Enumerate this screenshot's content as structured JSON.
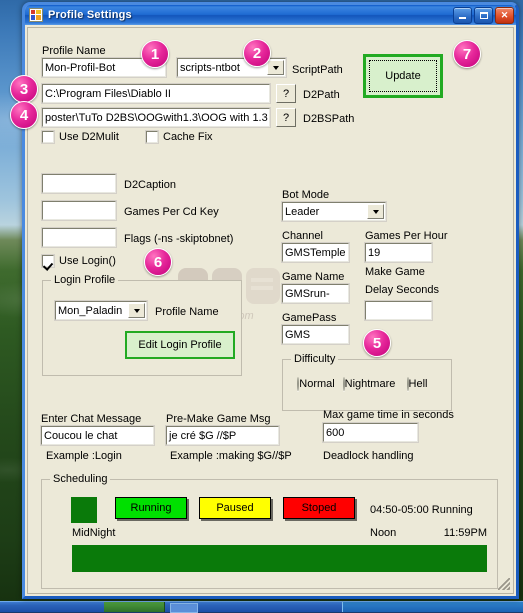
{
  "window": {
    "title": "Profile Settings",
    "icon": "profile-settings-icon",
    "buttons": {
      "minimize": "minimize",
      "maximize": "maximize",
      "close": "close"
    }
  },
  "profile": {
    "name_label": "Profile Name",
    "name_value": "Mon-Profil-Bot",
    "script_value": "scripts-ntbot",
    "script_label": "ScriptPath",
    "d2path_value": "C:\\Program Files\\Diablo II",
    "d2path_label": "D2Path",
    "d2path_browse": "?",
    "d2bspath_value": "poster\\TuTo D2BS\\OOGwith1.3\\OOG with 1.3",
    "d2bspath_label": "D2BSPath",
    "d2bspath_browse": "?",
    "use_d2mulit": "Use D2Mulit",
    "cache_fix": "Cache Fix",
    "update_button": "Update"
  },
  "left": {
    "d2caption_value": "",
    "d2caption_label": "D2Caption",
    "games_per_cd_key_value": "",
    "games_per_cd_key_label": "Games Per Cd Key",
    "flags_value": "",
    "flags_label": "Flags (-ns -skiptobnet)",
    "use_login_label": "Use Login()",
    "login_profile_group": "Login Profile",
    "login_profile_value": "Mon_Paladin",
    "profile_name_label": "Profile Name",
    "edit_login_profile": "Edit Login Profile"
  },
  "right": {
    "bot_mode_label": "Bot Mode",
    "bot_mode_value": "Leader",
    "channel_label": "Channel",
    "channel_value": "GMSTemple",
    "games_per_hour_label": "Games Per Hour",
    "games_per_hour_value": "19",
    "game_name_label": "Game Name",
    "game_name_value": "GMSrun-",
    "make_game_label": "Make Game",
    "delay_seconds_label": "Delay Seconds",
    "delay_seconds_value": "",
    "gamepass_label": "GamePass",
    "gamepass_value": "GMS",
    "difficulty_group": "Difficulty",
    "difficulty_options": [
      "Normal",
      "Nightmare",
      "Hell"
    ]
  },
  "messages": {
    "chat_label": "Enter Chat Message",
    "chat_value": "Coucou le chat",
    "chat_example": "Example :Login",
    "premake_label": "Pre-Make Game Msg",
    "premake_value": "je cré $G //$P",
    "premake_example": "Example :making $G//$P",
    "maxtime_label": "Max game time in seconds",
    "maxtime_value": "600",
    "deadlock_label": "Deadlock handling"
  },
  "scheduling": {
    "group_title": "Scheduling",
    "legend_swatch_color": "#0a7a0a",
    "running_label": "Running",
    "running_color": "#00e000",
    "paused_label": "Paused",
    "paused_color": "#ffff00",
    "stoped_label": "Stoped",
    "stoped_color": "#ff0000",
    "status_text": "04:50-05:00 Running",
    "axis_start": "MidNight",
    "axis_mid": "Noon",
    "axis_end": "11:59PM",
    "bar_color": "#0a7a0a"
  },
  "callouts": {
    "one": "1",
    "two": "2",
    "three": "3",
    "four": "4",
    "five": "5",
    "six": "6",
    "seven": "7"
  },
  "watermark": {
    "text": "gmstemple.com"
  }
}
